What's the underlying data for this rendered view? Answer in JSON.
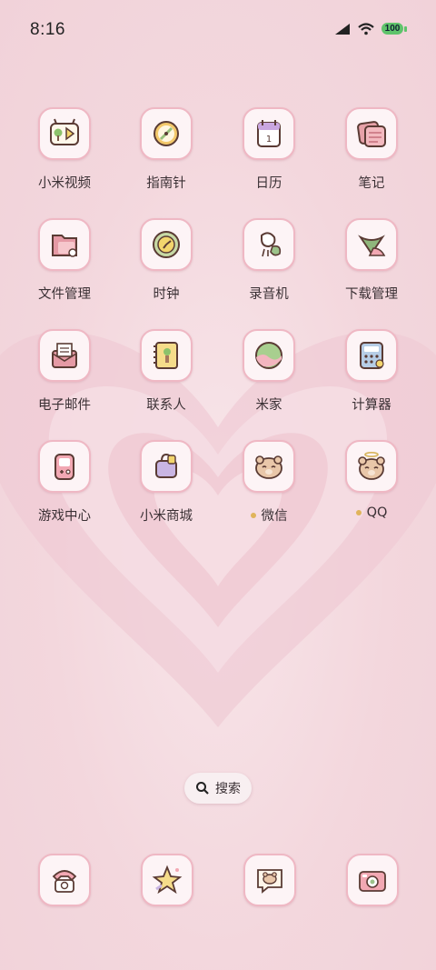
{
  "status_bar": {
    "time": "8:16",
    "battery": "100"
  },
  "apps": [
    {
      "label": "小米视频",
      "icon": "video-icon"
    },
    {
      "label": "指南针",
      "icon": "compass-icon"
    },
    {
      "label": "日历",
      "icon": "calendar-icon",
      "badge_text": "1"
    },
    {
      "label": "笔记",
      "icon": "notes-icon"
    },
    {
      "label": "文件管理",
      "icon": "folder-icon"
    },
    {
      "label": "时钟",
      "icon": "clock-icon"
    },
    {
      "label": "录音机",
      "icon": "recorder-icon"
    },
    {
      "label": "下载管理",
      "icon": "download-icon"
    },
    {
      "label": "电子邮件",
      "icon": "mail-icon"
    },
    {
      "label": "联系人",
      "icon": "contacts-icon"
    },
    {
      "label": "米家",
      "icon": "mijia-icon"
    },
    {
      "label": "计算器",
      "icon": "calculator-icon"
    },
    {
      "label": "游戏中心",
      "icon": "game-center-icon"
    },
    {
      "label": "小米商城",
      "icon": "store-icon"
    },
    {
      "label": "微信",
      "icon": "bear-icon",
      "new": true
    },
    {
      "label": "QQ",
      "icon": "angel-bear-icon",
      "new": true
    }
  ],
  "search": {
    "label": "搜索"
  },
  "dock": [
    {
      "icon": "phone-icon"
    },
    {
      "icon": "star-icon"
    },
    {
      "icon": "messages-icon"
    },
    {
      "icon": "camera-icon"
    }
  ],
  "colors": {
    "accent_border": "#efb8c4",
    "new_dot": "#e0b45b",
    "background": "#f3d7dd"
  }
}
